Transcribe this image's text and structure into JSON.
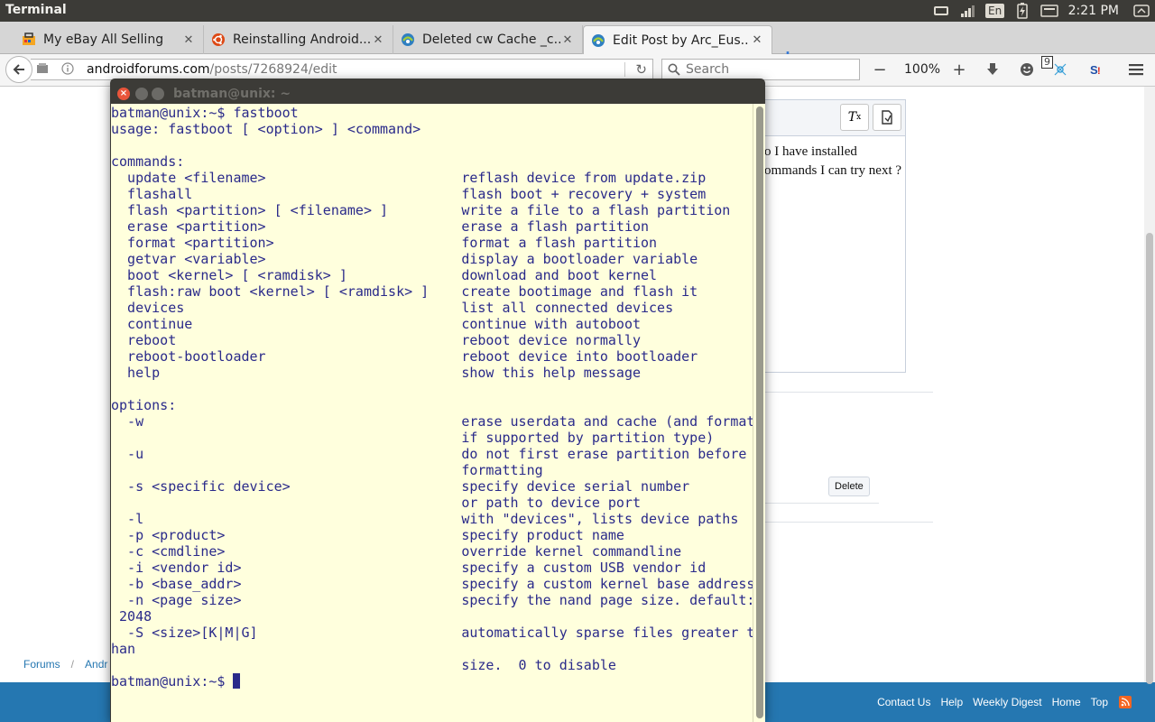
{
  "system_panel": {
    "app_title": "Terminal",
    "keyboard_layout": "En",
    "clock": "2:21 PM",
    "indicators": [
      "mail-icon",
      "network-signal-icon",
      "keyboard-layout-indicator",
      "battery-icon",
      "messaging-icon",
      "power-gear-icon"
    ]
  },
  "tabs": [
    {
      "label": "My eBay All Selling",
      "icon": "ebay-favicon"
    },
    {
      "label": "Reinstalling Android...",
      "icon": "ubuntu-favicon"
    },
    {
      "label": "Deleted cw Cache _c...",
      "icon": "forum-favicon"
    },
    {
      "label": "Edit Post by Arc_Eus...",
      "icon": "forum-favicon",
      "active": true
    }
  ],
  "navbar": {
    "url_host": "androidforums.com",
    "url_path": "/posts/7268924/edit",
    "search_placeholder": "Search",
    "zoom": "100%",
    "zoom_out": "−",
    "zoom_in": "+",
    "badge_count": "9"
  },
  "page": {
    "editor_text_lines": [
      "o I have installed",
      "ommands I can try next ?"
    ],
    "delete_label": "Delete",
    "breadcrumb": [
      "Forums",
      "Andr"
    ],
    "footer_links": [
      "Contact Us",
      "Help",
      "Weekly Digest",
      "Home",
      "Top"
    ]
  },
  "terminal": {
    "title": "batman@unix: ~",
    "prompt": "batman@unix:~$ ",
    "output": "batman@unix:~$ fastboot\nusage: fastboot [ <option> ] <command>\n\ncommands:\n  update <filename>                        reflash device from update.zip\n  flashall                                 flash boot + recovery + system\n  flash <partition> [ <filename> ]         write a file to a flash partition\n  erase <partition>                        erase a flash partition\n  format <partition>                       format a flash partition\n  getvar <variable>                        display a bootloader variable\n  boot <kernel> [ <ramdisk> ]              download and boot kernel\n  flash:raw boot <kernel> [ <ramdisk> ]    create bootimage and flash it\n  devices                                  list all connected devices\n  continue                                 continue with autoboot\n  reboot                                   reboot device normally\n  reboot-bootloader                        reboot device into bootloader\n  help                                     show this help message\n\noptions:\n  -w                                       erase userdata and cache (and format\n                                           if supported by partition type)\n  -u                                       do not first erase partition before\n                                           formatting\n  -s <specific device>                     specify device serial number\n                                           or path to device port\n  -l                                       with \"devices\", lists device paths\n  -p <product>                             specify product name\n  -c <cmdline>                             override kernel commandline\n  -i <vendor id>                           specify a custom USB vendor id\n  -b <base_addr>                           specify a custom kernel base address\n  -n <page size>                           specify the nand page size. default:\n 2048\n  -S <size>[K|M|G]                         automatically sparse files greater t\nhan\n                                           size.  0 to disable\n"
  }
}
